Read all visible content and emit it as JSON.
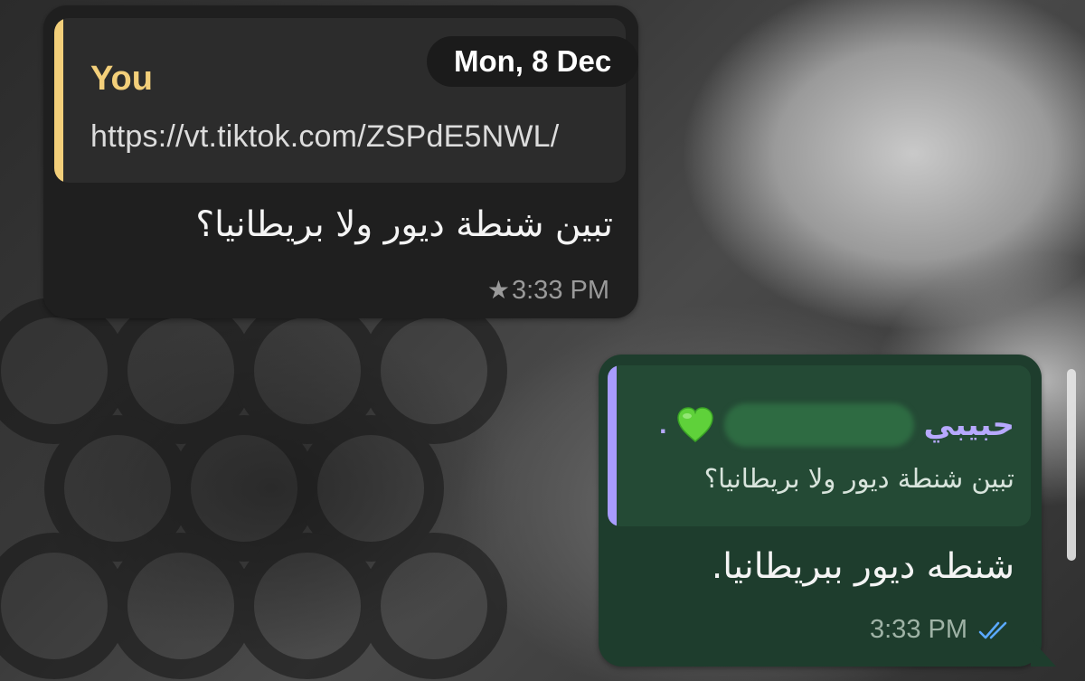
{
  "incoming": {
    "reply": {
      "sender": "You",
      "link": "https://vt.tiktok.com/ZSPdE5NWL/"
    },
    "text": "تبين شنطة ديور ولا بريطانيا؟",
    "time": "3:33 PM",
    "starred": true
  },
  "date_chip": "Mon, 8 Dec",
  "outgoing": {
    "reply": {
      "sender": "حبيبي",
      "sender_suffix": ".",
      "quoted": "تبين شنطة ديور ولا بريطانيا؟"
    },
    "text": "شنطه ديور ببريطانيا.",
    "time": "3:33 PM",
    "read": true
  },
  "colors": {
    "incoming_bubble": "#1f1f1f",
    "outgoing_bubble": "#1e3d2d",
    "you_accent": "#f3cf7a",
    "contact_accent": "#b7a9ff",
    "read_ticks": "#5aa9ff"
  },
  "icons": {
    "star": "star-icon",
    "heart": "green-heart-icon",
    "read": "double-check-icon"
  }
}
